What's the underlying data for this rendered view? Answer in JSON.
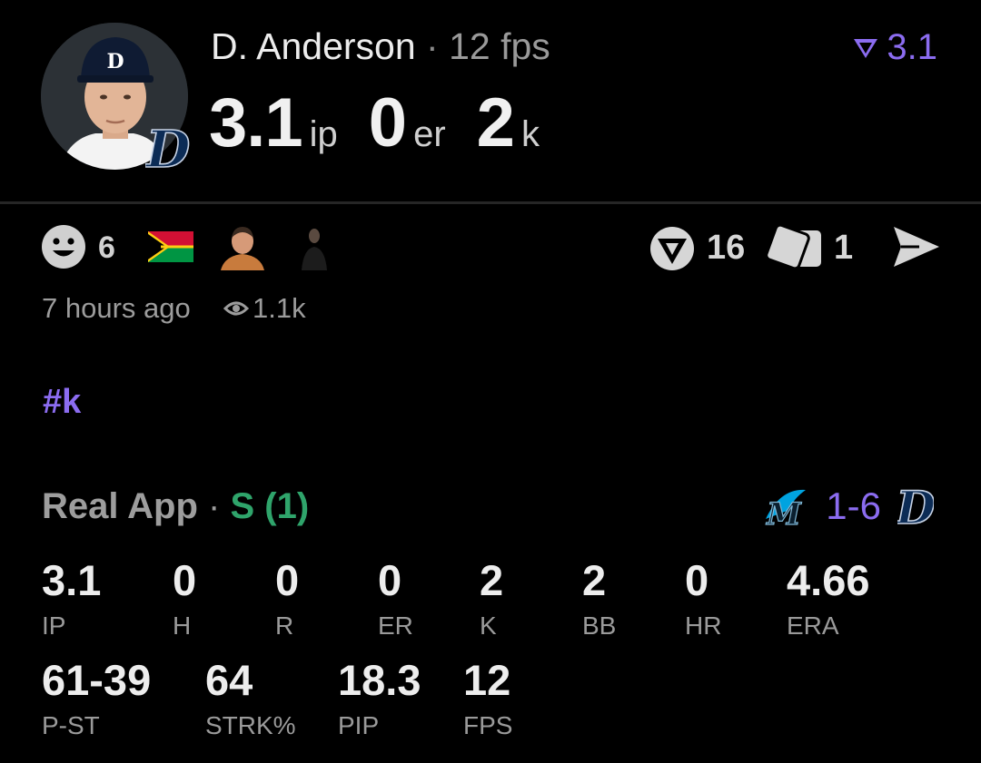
{
  "header": {
    "player_name": "D. Anderson",
    "separator": "·",
    "fps": "12 fps",
    "vote_score": "3.1",
    "statline": [
      {
        "value": "3.1",
        "unit": "ip"
      },
      {
        "value": "0",
        "unit": "er"
      },
      {
        "value": "2",
        "unit": "k"
      }
    ]
  },
  "reactions": {
    "smiley_count": "6",
    "vote_count": "16",
    "card_count": "1"
  },
  "meta": {
    "time_ago": "7 hours ago",
    "views": "1.1k"
  },
  "hashtag": "#k",
  "game": {
    "source": "Real App",
    "separator": "·",
    "result": "S (1)",
    "score": "1-6",
    "stats_row1": [
      {
        "value": "3.1",
        "label": "IP"
      },
      {
        "value": "0",
        "label": "H"
      },
      {
        "value": "0",
        "label": "R"
      },
      {
        "value": "0",
        "label": "ER"
      },
      {
        "value": "2",
        "label": "K"
      },
      {
        "value": "2",
        "label": "BB"
      },
      {
        "value": "0",
        "label": "HR"
      },
      {
        "value": "4.66",
        "label": "ERA"
      }
    ],
    "stats_row2": [
      {
        "value": "61-39",
        "label": "P-ST"
      },
      {
        "value": "64",
        "label": "STRK%"
      },
      {
        "value": "18.3",
        "label": "PIP"
      },
      {
        "value": "12",
        "label": "FPS"
      }
    ]
  },
  "colors": {
    "accent": "#8b6cf0",
    "save_green": "#2fa46b",
    "background": "#000000"
  }
}
